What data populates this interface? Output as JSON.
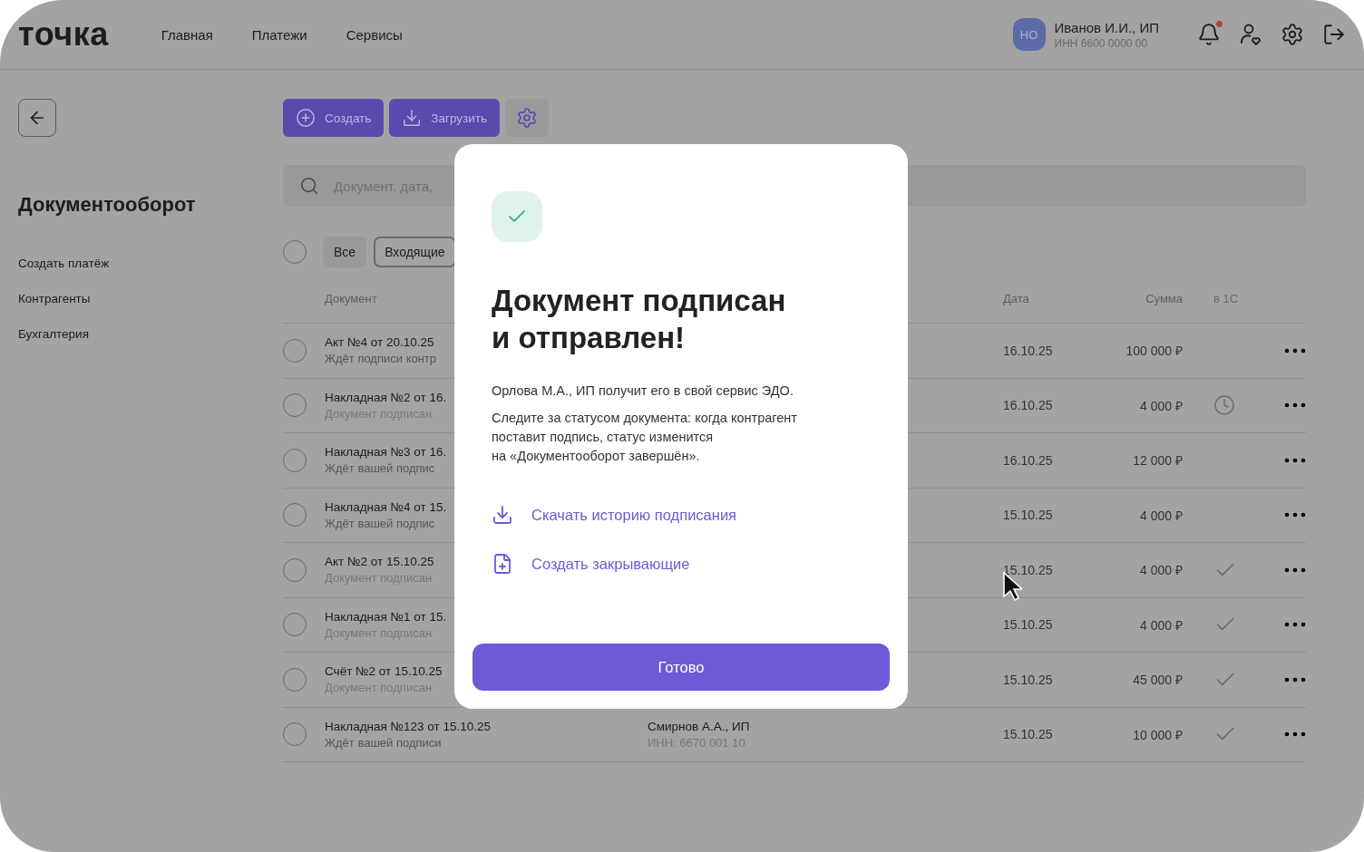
{
  "header": {
    "logo": "точка",
    "nav": [
      {
        "label": "Главная"
      },
      {
        "label": "Платежи"
      },
      {
        "label": "Сервисы"
      }
    ],
    "account": {
      "initials": "НО",
      "name": "Иванов И.И., ИП",
      "inn": "ИНН 6600 0000 00"
    },
    "notifications": {
      "unread": true
    }
  },
  "sidebar": {
    "title": "Документооборот",
    "items": [
      {
        "label": "Создать платёж"
      },
      {
        "label": "Контрагенты"
      },
      {
        "label": "Бухгалтерия"
      }
    ]
  },
  "toolbar": {
    "buttons": [
      {
        "label": "Создать",
        "kind": "create"
      },
      {
        "label": "Загрузить",
        "kind": "upload"
      }
    ]
  },
  "search": {
    "placeholder": "Документ, дата,"
  },
  "select_all": {
    "checked": false
  },
  "filters": [
    {
      "label": "Все",
      "selected": false
    },
    {
      "label": "Входящие",
      "selected": true
    }
  ],
  "table": {
    "columns": [
      "Документ",
      "Дата",
      "Сумма",
      "в 1С"
    ],
    "rows": [
      {
        "selected": false,
        "title": "Акт №4 от 20.10.25",
        "status": "Ждёт подписи контр",
        "muted": false,
        "date": "16.10.25",
        "amount": "100 000 ₽",
        "in_1c": false,
        "pending": false
      },
      {
        "selected": false,
        "title": "Накладная №2 от 16.",
        "status": "Документ подписан",
        "muted": true,
        "date": "16.10.25",
        "amount": "4 000 ₽",
        "in_1c": false,
        "pending": true
      },
      {
        "selected": false,
        "title": "Накладная №3 от 16.",
        "status": "Ждёт вашей подпис",
        "muted": false,
        "date": "16.10.25",
        "amount": "12 000 ₽",
        "in_1c": false,
        "pending": false
      },
      {
        "selected": false,
        "title": "Накладная №4 от 15.",
        "status": "Ждёт вашей подпис",
        "muted": false,
        "date": "15.10.25",
        "amount": "4 000 ₽",
        "in_1c": false,
        "pending": false
      },
      {
        "selected": false,
        "title": "Акт №2 от 15.10.25",
        "status": "Документ подписан",
        "muted": true,
        "date": "15.10.25",
        "amount": "4 000 ₽",
        "in_1c": true,
        "pending": false
      },
      {
        "selected": false,
        "title": "Накладная №1 от 15.",
        "status": "Документ подписан",
        "muted": true,
        "date": "15.10.25",
        "amount": "4 000 ₽",
        "in_1c": true,
        "pending": false
      },
      {
        "selected": false,
        "title": "Счёт №2 от 15.10.25",
        "status": "Документ подписан",
        "muted": true,
        "date": "15.10.25",
        "amount": "45 000 ₽",
        "in_1c": true,
        "pending": false
      },
      {
        "selected": false,
        "title": "Накладная №123 от 15.10.25",
        "status": "Ждёт вашей подписи",
        "muted": false,
        "counterparty": "Смирнов А.А., ИП",
        "counterparty_inn": "ИНН: 6670 001 10",
        "date": "15.10.25",
        "amount": "10 000 ₽",
        "in_1c": true,
        "pending": false
      }
    ]
  },
  "modal": {
    "title": "Документ подписан и отправлен!",
    "paragraphs": [
      "Орлова М.А., ИП получит его в свой сервис ЭДО.",
      "Следите за статусом документа: когда контрагент поставит подпись, статус изменится\nна «Документооборот завершён»."
    ],
    "links": [
      {
        "label": "Скачать историю подписания",
        "kind": "download"
      },
      {
        "label": "Создать закрывающие",
        "kind": "create-docs"
      }
    ],
    "button": "Готово"
  }
}
